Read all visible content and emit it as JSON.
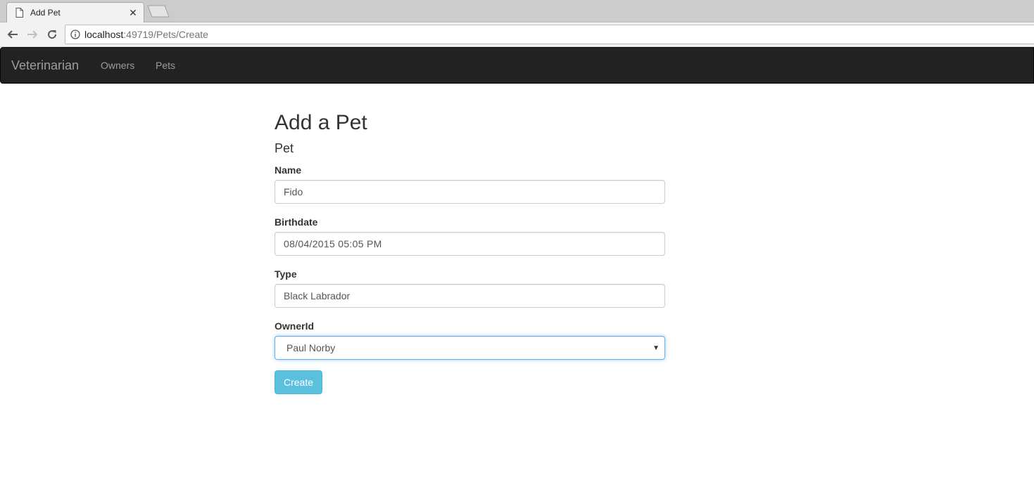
{
  "browser": {
    "tab_title": "Add Pet",
    "url_host": "localhost",
    "url_path": ":49719/Pets/Create"
  },
  "navbar": {
    "brand": "Veterinarian",
    "links": [
      "Owners",
      "Pets"
    ]
  },
  "page": {
    "title": "Add a Pet",
    "section": "Pet"
  },
  "form": {
    "name_label": "Name",
    "name_value": "Fido",
    "birthdate_label": "Birthdate",
    "birthdate_value": "08/04/2015 05:05 PM",
    "type_label": "Type",
    "type_value": "Black Labrador",
    "owner_label": "OwnerId",
    "owner_value": "Paul Norby",
    "submit_label": "Create"
  },
  "colors": {
    "navbar_bg": "#222222",
    "nav_text": "#9d9d9d",
    "button_info": "#5bc0de",
    "focus_border": "#66afe9"
  },
  "icons": {
    "tab": "document-icon",
    "close": "close-icon",
    "back": "back-arrow-icon",
    "forward": "forward-arrow-icon",
    "reload": "reload-icon",
    "info": "info-icon",
    "dropdown": "chevron-down-icon"
  }
}
